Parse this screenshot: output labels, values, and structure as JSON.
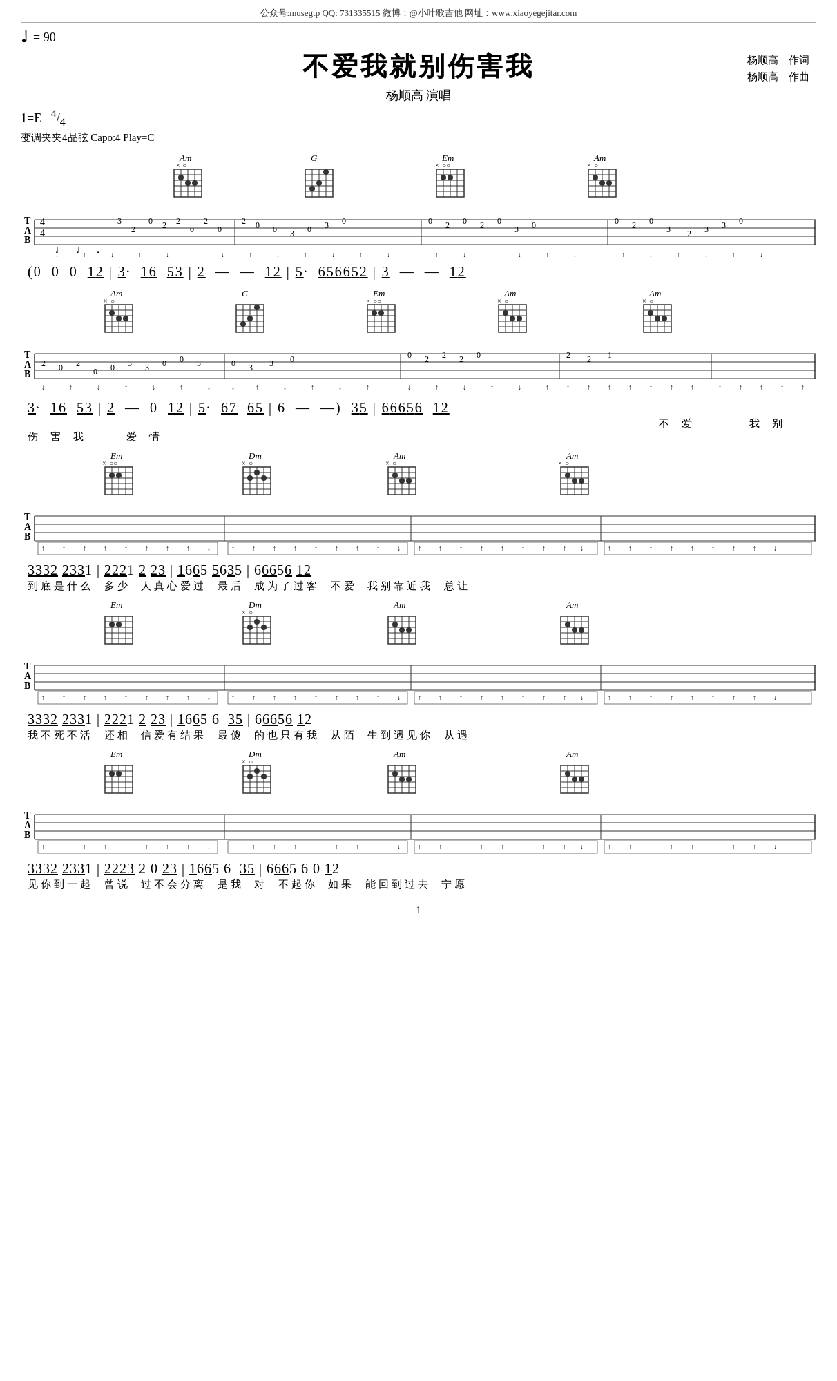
{
  "header": {
    "text": "公众号:musegtp  QQ: 731335515  微博：@小叶歌吉他  网址：www.xiaoyegejitar.com"
  },
  "song": {
    "title": "不爱我就别伤害我",
    "subtitle": "杨顺高  演唱",
    "tempo": "= 90",
    "key": "1=E",
    "time": "4/4",
    "capo": "变调夹夹4品弦  Capo:4  Play=C",
    "lyricist": "杨顺高　作词",
    "composer": "杨顺高　作曲"
  },
  "page_number": "1"
}
